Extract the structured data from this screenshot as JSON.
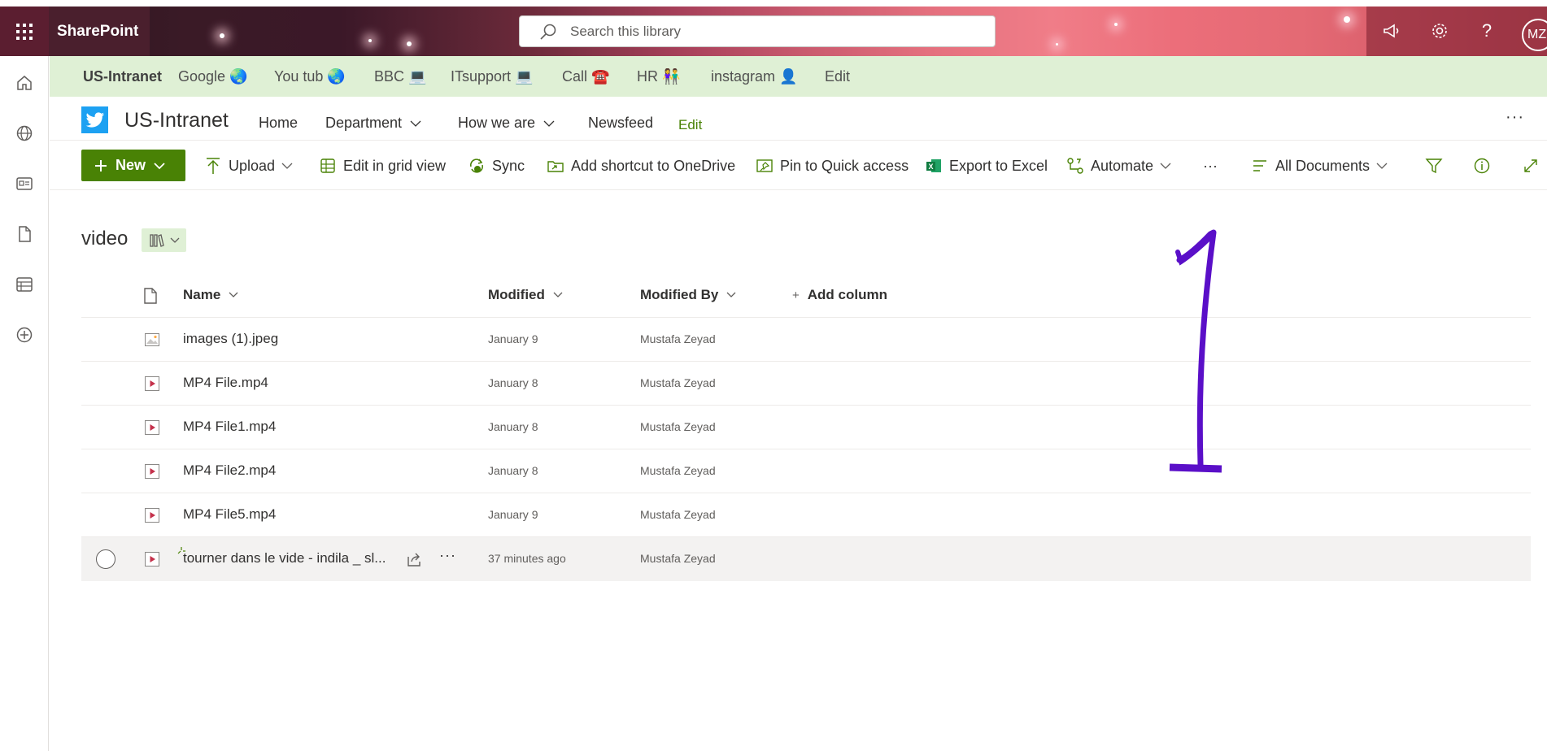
{
  "suite": {
    "app_name": "SharePoint",
    "search_placeholder": "Search this library",
    "avatar_initials": "MZ"
  },
  "hub_nav": {
    "title": "US-Intranet",
    "items": [
      {
        "label": "Google 🌏"
      },
      {
        "label": "You tub 🌏"
      },
      {
        "label": "BBC 💻"
      },
      {
        "label": "ITsupport 💻"
      },
      {
        "label": "Call ☎️"
      },
      {
        "label": "HR 👫"
      },
      {
        "label": "instagram 👤"
      },
      {
        "label": "Edit"
      }
    ]
  },
  "site": {
    "title": "US-Intranet",
    "nav": [
      {
        "label": "Home",
        "has_dropdown": false
      },
      {
        "label": "Department",
        "has_dropdown": true
      },
      {
        "label": "How we are",
        "has_dropdown": true
      },
      {
        "label": "Newsfeed",
        "has_dropdown": false
      }
    ],
    "edit_label": "Edit"
  },
  "commands": {
    "new_label": "New",
    "upload": "Upload",
    "edit_grid": "Edit in grid view",
    "sync": "Sync",
    "shortcut": "Add shortcut to OneDrive",
    "pin": "Pin to Quick access",
    "export": "Export to Excel",
    "automate": "Automate",
    "view": "All Documents"
  },
  "library": {
    "title": "video",
    "columns": {
      "name": "Name",
      "modified": "Modified",
      "modified_by": "Modified By",
      "add_column": "Add column"
    },
    "rows": [
      {
        "name": "images (1).jpeg",
        "type": "image",
        "modified": "January 9",
        "modified_by": "Mustafa Zeyad"
      },
      {
        "name": "MP4 File.mp4",
        "type": "video",
        "modified": "January 8",
        "modified_by": "Mustafa Zeyad"
      },
      {
        "name": "MP4 File1.mp4",
        "type": "video",
        "modified": "January 8",
        "modified_by": "Mustafa Zeyad"
      },
      {
        "name": "MP4 File2.mp4",
        "type": "video",
        "modified": "January 8",
        "modified_by": "Mustafa Zeyad"
      },
      {
        "name": "MP4 File5.mp4",
        "type": "video",
        "modified": "January 9",
        "modified_by": "Mustafa Zeyad"
      },
      {
        "name": "tourner dans le vide - indila _ sl...",
        "type": "video",
        "modified": "37 minutes ago",
        "modified_by": "Mustafa Zeyad",
        "hovered": true,
        "is_new": true
      }
    ]
  },
  "annotation": {
    "text": "1",
    "color": "#5a0fc8"
  },
  "colors": {
    "accent": "#498205",
    "hub_bg": "#dff0d5",
    "site_logo": "#1da1f2",
    "video_icon": "#c4314b"
  }
}
